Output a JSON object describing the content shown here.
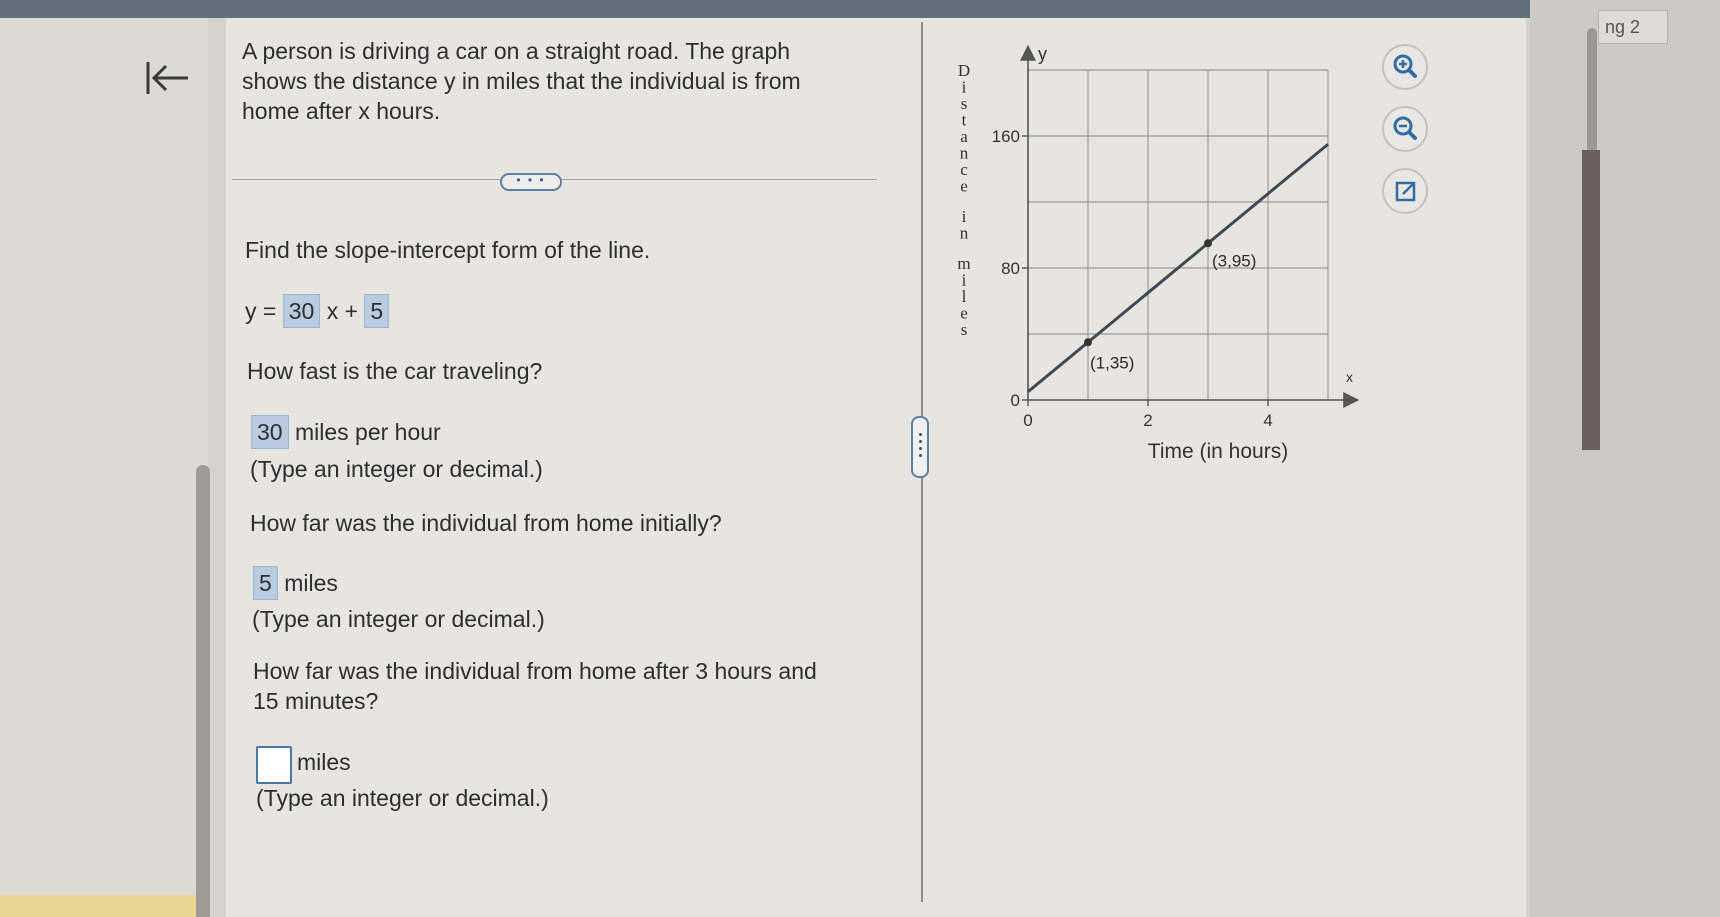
{
  "question": {
    "intro_lines": [
      "A person is driving a car on a straight road. The graph",
      "shows the distance y in miles that the individual is from",
      "home after x hours."
    ],
    "more_button": "• • •",
    "part1_prompt": "Find the slope-intercept form of the line.",
    "eq_prefix": "y =",
    "eq_slope": "30",
    "eq_middle": "x +",
    "eq_intercept": "5",
    "part2_prompt": "How fast is the car traveling?",
    "part2_answer": "30",
    "part2_unit": "miles per hour",
    "part2_hint": "(Type an integer or decimal.)",
    "part3_prompt": "How far was the individual from home initially?",
    "part3_answer": "5",
    "part3_unit": "miles",
    "part3_hint": "(Type an integer or decimal.)",
    "part4_prompt_lines": [
      "How far was the individual from home after 3 hours and",
      "15 minutes?"
    ],
    "part4_answer": "",
    "part4_unit": "miles",
    "part4_hint": "(Type an integer or decimal.)"
  },
  "right_pane": {
    "tab_label": "ng 2"
  },
  "icons": [
    "back-to-start-icon",
    "zoom-in-icon",
    "zoom-out-icon",
    "open-external-icon"
  ],
  "colors": {
    "answer_highlight": "#b9cbe0",
    "accent_blue": "#4b76ad",
    "panel": "#e7e5e0"
  },
  "chart_data": {
    "type": "line",
    "x_axis_letter": "x",
    "y_axis_letter": "y",
    "xlabel": "Time (in hours)",
    "ylabel": "Distance in miles",
    "x_ticks": [
      "0",
      "2",
      "4"
    ],
    "y_ticks": [
      "0",
      "80",
      "160"
    ],
    "xlim": [
      0,
      5
    ],
    "ylim": [
      0,
      200
    ],
    "grid": true,
    "series": [
      {
        "x": [
          0,
          5
        ],
        "y": [
          5,
          155
        ]
      }
    ],
    "points": [
      {
        "x": 1,
        "y": 35,
        "label": "(1,35)"
      },
      {
        "x": 3,
        "y": 95,
        "label": "(3,95)"
      }
    ]
  }
}
